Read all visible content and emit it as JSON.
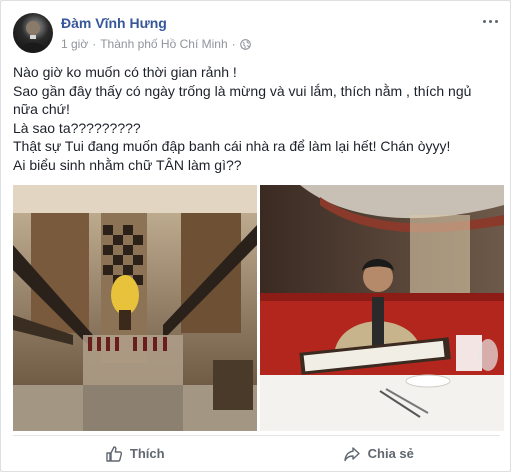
{
  "post": {
    "author": "Đàm Vĩnh Hưng",
    "time": "1 giờ",
    "separator": "·",
    "location": "Thành phố Hồ Chí Minh",
    "privacy_icon": "globe-icon",
    "menu_icon": "more-options-icon",
    "lines": [
      "Nào giờ ko muốn có thời gian rảnh !",
      "Sao gần đây thấy có ngày trống là mừng và vui lắm, thích nằm , thích ngủ nữa chứ!",
      "Là sao ta?????????",
      "Thật sự Tui đang muốn đập banh cái nhà ra để làm lại hết! Chán òyyy!",
      "Ai biểu sinh nhằm chữ TÂN làm gì??"
    ]
  },
  "actions": {
    "like_label": "Thích",
    "like_icon": "thumbs-up-icon",
    "share_label": "Chia sẻ",
    "share_icon": "share-icon"
  },
  "colors": {
    "name": "#365899",
    "meta": "#90949c",
    "text": "#1d2129",
    "action": "#606770"
  }
}
